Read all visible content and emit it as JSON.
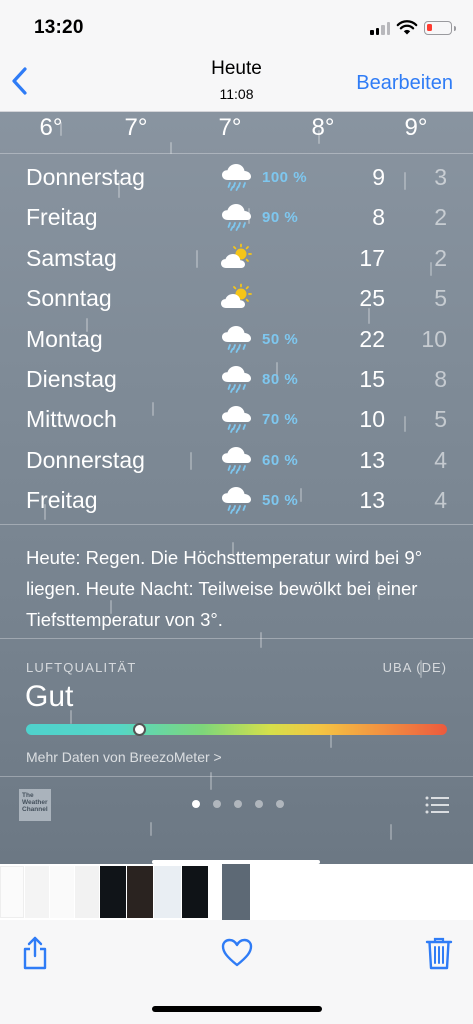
{
  "status_bar": {
    "time": "13:20",
    "battery_level": 0.15
  },
  "nav": {
    "back_icon": "chevron-left-icon",
    "title": "Heute",
    "subtitle": "11:08",
    "edit_label": "Bearbeiten"
  },
  "weather": {
    "hourly_temps": [
      "6°",
      "7°",
      "7°",
      "8°",
      "9°"
    ],
    "days": [
      {
        "name": "Donnerstag",
        "icon": "rain-cloud-icon",
        "precip": "100 %",
        "high": "9",
        "low": "3"
      },
      {
        "name": "Freitag",
        "icon": "rain-cloud-icon",
        "precip": "90 %",
        "high": "8",
        "low": "2"
      },
      {
        "name": "Samstag",
        "icon": "partly-sunny-icon",
        "precip": "",
        "high": "17",
        "low": "2"
      },
      {
        "name": "Sonntag",
        "icon": "partly-sunny-icon",
        "precip": "",
        "high": "25",
        "low": "5"
      },
      {
        "name": "Montag",
        "icon": "rain-cloud-icon",
        "precip": "50 %",
        "high": "22",
        "low": "10"
      },
      {
        "name": "Dienstag",
        "icon": "rain-cloud-icon",
        "precip": "80 %",
        "high": "15",
        "low": "8"
      },
      {
        "name": "Mittwoch",
        "icon": "rain-cloud-icon",
        "precip": "70 %",
        "high": "10",
        "low": "5"
      },
      {
        "name": "Donnerstag",
        "icon": "rain-cloud-icon",
        "precip": "60 %",
        "high": "13",
        "low": "4"
      },
      {
        "name": "Freitag",
        "icon": "rain-cloud-icon",
        "precip": "50 %",
        "high": "13",
        "low": "4"
      }
    ],
    "summary": "Heute: Regen. Die Höchsttemperatur wird bei 9° liegen. Heute Nacht: Teilweise bewölkt bei einer Tiefsttemperatur von 3°.",
    "air_quality": {
      "label": "LUFTQUALITÄT",
      "source": "UBA (DE)",
      "value": "Gut",
      "level": 0.27,
      "more_link": "Mehr Daten von BreezoMeter >"
    },
    "provider_logo_text": "The Weather Channel",
    "page_count": 5,
    "active_page": 0
  },
  "toolbar": {
    "share_icon": "share-icon",
    "favorite_icon": "heart-icon",
    "delete_icon": "trash-icon"
  },
  "colors": {
    "accent": "#2f7cf6",
    "precip": "#7ec7ef",
    "sky_top": "#8994a0",
    "sky_bottom": "#6c7884"
  }
}
